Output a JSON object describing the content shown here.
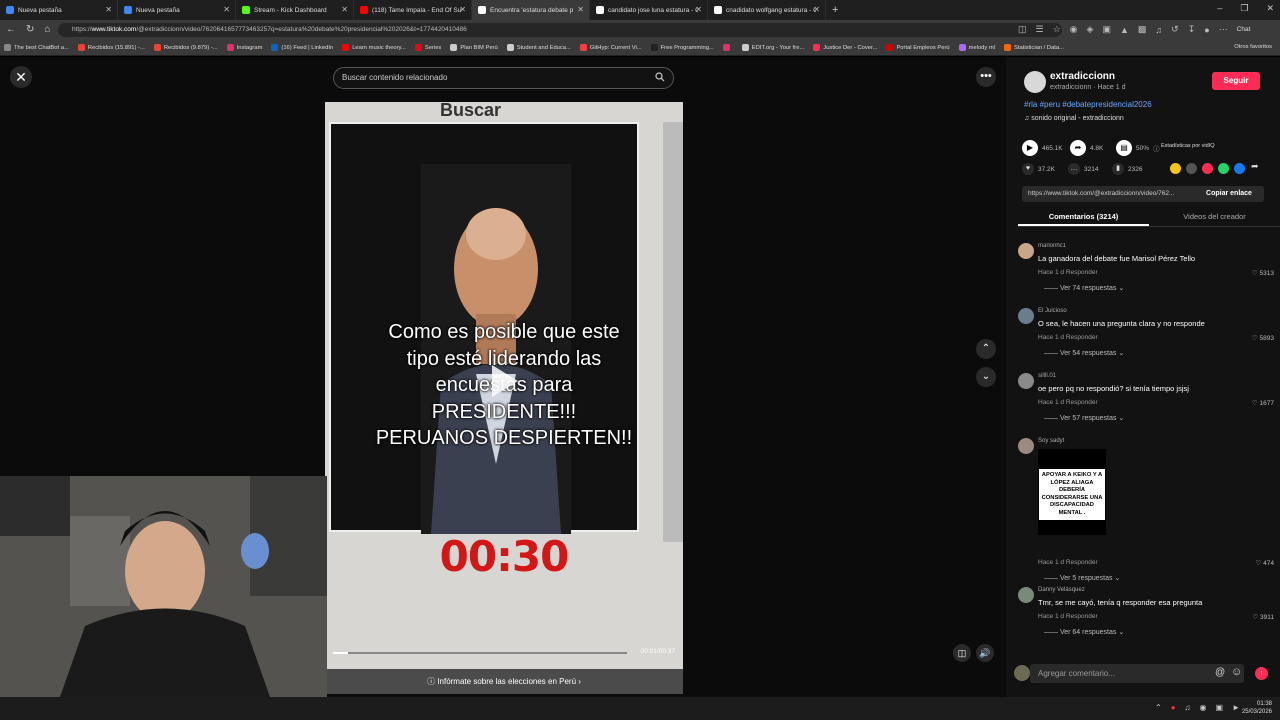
{
  "browser": {
    "tabs": [
      {
        "title": "Nueva pestaña",
        "color": "#4285f4",
        "active": false
      },
      {
        "title": "Nueva pestaña",
        "color": "#4285f4",
        "active": false
      },
      {
        "title": "Stream - Kick Dashboard",
        "color": "#53fc18",
        "active": false
      },
      {
        "title": "(118) Tame Impala - End Of Summ",
        "color": "#ff0000",
        "active": false
      },
      {
        "title": "Encuentra 'estatura debate p",
        "color": "#ffffff",
        "active": true
      },
      {
        "title": "candidato jose luna estatura - Go",
        "color": "#ffffff",
        "active": false
      },
      {
        "title": "cnadidato wolfgang estatura - Go",
        "color": "#ffffff",
        "active": false
      }
    ],
    "url_prefix": "https://",
    "url_host": "www.tiktok.com",
    "url_rest": "/@extradiccionn/video/7620641657773463257q=estatura%20debate%20presidencial%202026&t=1774420410486",
    "bookmarks": [
      {
        "label": "The best ChatBot a...",
        "color": "#888888"
      },
      {
        "label": "Recibidos (15.891) -...",
        "color": "#ea4335"
      },
      {
        "label": "Recibidos (9.879) -...",
        "color": "#ea4335"
      },
      {
        "label": "Instagram",
        "color": "#e1306c"
      },
      {
        "label": "(16) Feed | LinkedIn",
        "color": "#0a66c2"
      },
      {
        "label": "Learn music theory...",
        "color": "#ff0000"
      },
      {
        "label": "Series",
        "color": "#e50914"
      },
      {
        "label": "Plan BIM Perú",
        "color": "#cccccc"
      },
      {
        "label": "Student and Educa...",
        "color": "#cccccc"
      },
      {
        "label": "GitHyp: Current Vi...",
        "color": "#fc3c44"
      },
      {
        "label": "Free Programming...",
        "color": "#222222"
      },
      {
        "label": "",
        "color": "#e1306c"
      },
      {
        "label": "EDIT.org - Your fre...",
        "color": "#cccccc"
      },
      {
        "label": "Justice Der - Cover...",
        "color": "#fe2c55"
      },
      {
        "label": "Portal Empleos Perú",
        "color": "#d00000"
      },
      {
        "label": "melody ml",
        "color": "#aa66ff"
      },
      {
        "label": "Statistician / Data...",
        "color": "#ff6600"
      }
    ],
    "otros": "Otros favoritos",
    "chat_label": "Chat"
  },
  "player": {
    "search_placeholder": "Buscar contenido relacionado",
    "sign_text": "Buscar",
    "overlay_lines": [
      "Como es posible que este",
      "tipo esté liderando las",
      "encuestas para",
      "PRESIDENTE!!!",
      "PERUANOS DESPIERTEN!!"
    ],
    "timer": "00:30",
    "time": "00:01/00:37",
    "progress": 0.05,
    "info_bar": "Infórmate sobre las elecciones en Perú"
  },
  "post": {
    "username": "extradiccionn",
    "subline": "extradiccionn · Hace 1 d",
    "follow": "Seguir",
    "hashtags": "#rla #peru #debatepresidencial2026",
    "sound": "sonido original - extradiccionn",
    "stats_row1": [
      "465.1K",
      "4.8K",
      "50%"
    ],
    "stats_label": "Estadísticas por vidIQ",
    "likes": "37.2K",
    "comments_count": "3214",
    "saves": "2326",
    "link": "https://www.tiktok.com/@extradiccionn/video/762...",
    "copy": "Copiar enlace",
    "tab_comments": "Comentarios (3214)",
    "tab_videos": "Videos del creador",
    "share_colors": [
      "#f5c518",
      "#555555",
      "#fe2c55",
      "#25d366",
      "#1877f2"
    ]
  },
  "comments": [
    {
      "user": "marlonhc1",
      "text": "La ganadora del debate fue Marisol Pérez Tello",
      "meta": "Hace 1 d    Responder",
      "likes": "5313",
      "replies": "Ver 74 respuestas",
      "avatar": "#c9a68a"
    },
    {
      "user": "El Juicioso",
      "text": "O sea, le hacen una pregunta clara y no responde",
      "meta": "Hace 1 d    Responder",
      "likes": "5893",
      "replies": "Ver 54 respuestas",
      "avatar": "#6b7d8c"
    },
    {
      "user": "sillll.01",
      "text": "oe pero pq no respondió? si tenía tiempo jsjsj",
      "meta": "Hace 1 d    Responder",
      "likes": "1677",
      "replies": "Ver 57 respuestas",
      "avatar": "#8a8a8a"
    },
    {
      "user": "Soy sadyt",
      "text": "",
      "meta": "Hace 1 d    Responder",
      "likes": "474",
      "replies": "Ver 5 respuestas",
      "avatar": "#9c8a80",
      "image_text": "APOYAR A KEIKO Y A LÓPEZ ALIAGA DEBERÍA CONSIDERARSE UNA DISCAPACIDAD MENTAL ."
    },
    {
      "user": "Danny Velásquez",
      "text": "Tmr, se me cayó, tenía q responder esa pregunta",
      "meta": "Hace 1 d    Responder",
      "likes": "3911",
      "replies": "Ver 64 respuestas",
      "avatar": "#7a8a7a"
    }
  ],
  "add_comment_placeholder": "Agregar comentario...",
  "clock": {
    "time": "01:38",
    "date": "25/03/2026"
  }
}
